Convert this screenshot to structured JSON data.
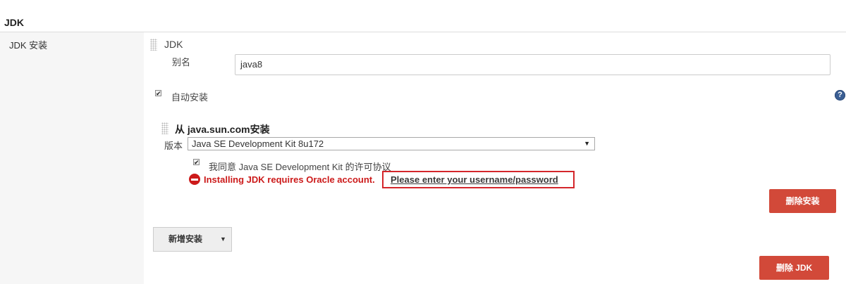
{
  "section": {
    "title": "JDK"
  },
  "setting": {
    "label": "JDK 安装"
  },
  "jdk_block": {
    "title": "JDK",
    "alias_label": "别名",
    "alias_value": "java8"
  },
  "auto_install": {
    "checked": true,
    "check_glyph": "✔",
    "label": "自动安装",
    "help_glyph": "?"
  },
  "installer": {
    "title": "从 java.sun.com安装",
    "version_label": "版本",
    "version_selected": "Java SE Development Kit 8u172",
    "select_arrow": "▼",
    "license_checked": true,
    "license_label": "我同意 Java SE Development Kit 的许可协议",
    "error_text": "Installing JDK requires Oracle account.",
    "error_link": "Please enter your username/password",
    "delete_installer_label": "删除安装"
  },
  "add_installer": {
    "label": "新增安装",
    "caret": "▼"
  },
  "delete_jdk": {
    "label": "删除 JDK"
  },
  "colors": {
    "danger": "#d24939",
    "error": "#cc1a1a",
    "highlight": "#d4262b",
    "help": "#3b5f94"
  },
  "icons": [
    "drag-handle-icon",
    "checkbox-icon",
    "help-icon",
    "error-icon",
    "dropdown-caret-icon"
  ]
}
